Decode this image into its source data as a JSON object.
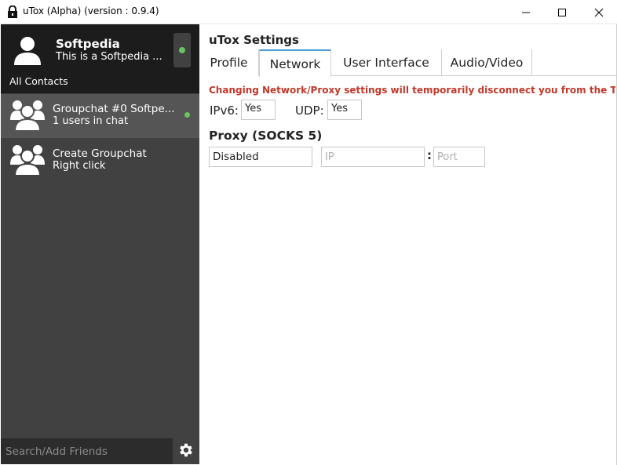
{
  "window": {
    "title": "uTox (Alpha) (version : 0.9.4)",
    "min_icon": "minimize-icon",
    "max_icon": "maximize-icon",
    "close_icon": "close-icon"
  },
  "sidebar": {
    "self": {
      "name": "Softpedia",
      "status_message": "This is a Softpedia ...",
      "status": "online",
      "status_color": "#6bc260"
    },
    "filter_label": "All Contacts",
    "contacts": [
      {
        "name": "Groupchat #0 Softpe...",
        "sub": "1 users in chat",
        "icon": "group-avatar-icon",
        "online": true
      },
      {
        "name": "Create Groupchat",
        "sub": "Right click",
        "icon": "group-avatar-icon",
        "online": false
      }
    ],
    "search": {
      "placeholder": "Search/Add Friends",
      "value": ""
    },
    "settings_icon": "gear-icon"
  },
  "main": {
    "title": "uTox Settings",
    "tabs": [
      {
        "label": "Profile",
        "active": false
      },
      {
        "label": "Network",
        "active": true
      },
      {
        "label": "User Interface",
        "active": false
      },
      {
        "label": "Audio/Video",
        "active": false
      }
    ],
    "active_tab_color": "#4a9ad6",
    "network": {
      "warning": "Changing Network/Proxy settings will temporarily disconnect you from the Tox ne",
      "warning_color": "#c0392b",
      "ipv6_label": "IPv6:",
      "ipv6_value": "Yes",
      "udp_label": "UDP:",
      "udp_value": "Yes",
      "proxy_title": "Proxy (SOCKS 5)",
      "proxy_value": "Disabled",
      "ip_placeholder": "IP",
      "ip_value": "",
      "separator": ":",
      "port_placeholder": "Port",
      "port_value": ""
    }
  }
}
